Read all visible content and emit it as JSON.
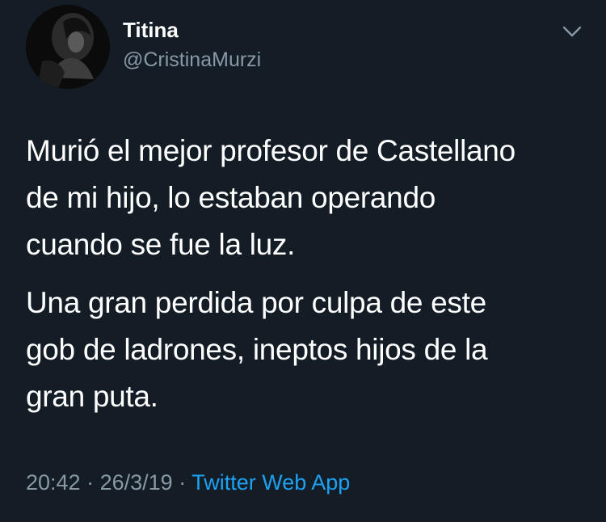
{
  "author": {
    "display_name": "Titina",
    "handle": "@CristinaMurzi",
    "avatar_icon": "profile-photo"
  },
  "menu": {
    "icon": "chevron-down-icon"
  },
  "tweet": {
    "paragraphs": [
      "Murió el mejor profesor de Castellano\nde mi hijo, lo estaban operando\ncuando se fue la luz.",
      "Una gran perdida por culpa de este\ngob de ladrones, ineptos hijos de la\ngran puta."
    ]
  },
  "meta": {
    "time": "20:42",
    "separator": "·",
    "date": "26/3/19",
    "source": "Twitter Web App"
  },
  "colors": {
    "background": "#141d26",
    "text": "#ffffff",
    "secondary": "#8899a6",
    "link": "#1da1f2"
  }
}
